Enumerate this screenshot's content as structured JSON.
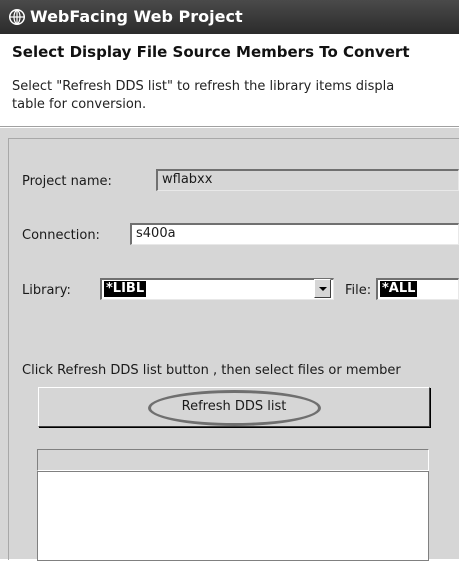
{
  "window": {
    "title": "WebFacing Web Project",
    "icon": "globe-icon"
  },
  "header": {
    "title": "Select Display File Source Members To Convert",
    "description_line1": "Select \"Refresh DDS list\" to refresh the library items displa",
    "description_line2": "table for conversion."
  },
  "form": {
    "project_name_label": "Project name:",
    "project_name_value": "wflabxx",
    "connection_label": "Connection:",
    "connection_value": "s400a",
    "library_label": "Library:",
    "library_value": "*LIBL",
    "file_label": "File:",
    "file_value": "*ALL"
  },
  "instructions": "Click Refresh DDS list button , then select files or member",
  "refresh_button_label": "Refresh DDS list",
  "colors": {
    "title_bar": "#2b2b2b",
    "panel": "#d6d6d6",
    "highlight_ellipse": "#6f6f6f"
  }
}
